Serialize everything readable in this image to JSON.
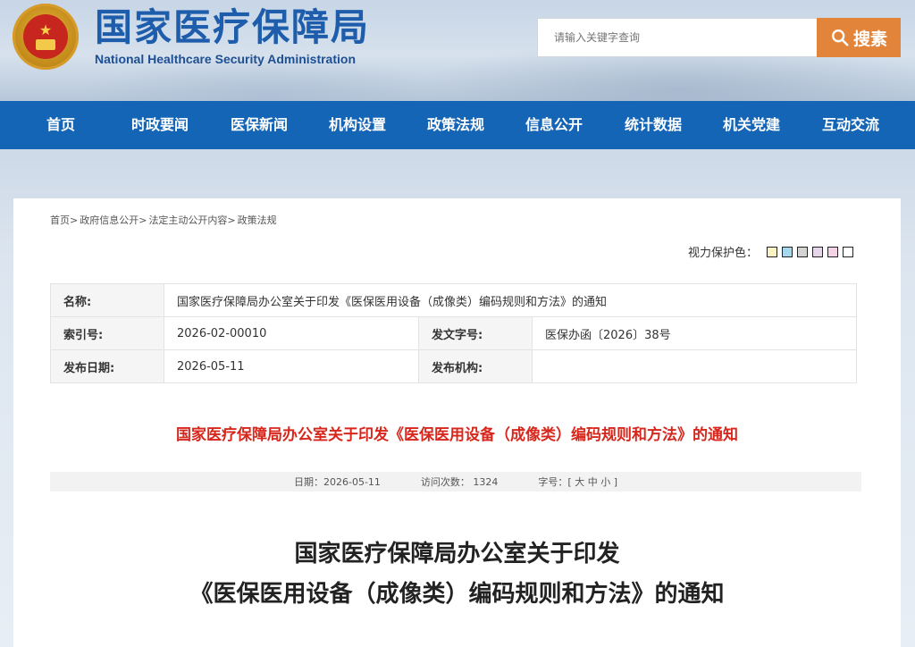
{
  "header": {
    "title_cn": "国家医疗保障局",
    "title_en": "National Healthcare Security Administration",
    "search_placeholder": "请输入关键字查询",
    "search_button": "搜素"
  },
  "nav": {
    "items": [
      "首页",
      "时政要闻",
      "医保新闻",
      "机构设置",
      "政策法规",
      "信息公开",
      "统计数据",
      "机关党建",
      "互动交流"
    ]
  },
  "breadcrumb": [
    "首页>",
    "政府信息公开>",
    "法定主动公开内容>",
    "政策法规"
  ],
  "vision": {
    "label": "视力保护色：",
    "colors": [
      "#fbf3c3",
      "#a5d8ef",
      "#d3d3d3",
      "#e5d4ea",
      "#f3d2e6",
      "#ffffff"
    ]
  },
  "meta": {
    "name_label": "名称:",
    "name_value": "国家医疗保障局办公室关于印发《医保医用设备（成像类）编码规则和方法》的通知",
    "index_label": "索引号:",
    "index_value": "2026-02-00010",
    "doc_no_label": "发文字号:",
    "doc_no_value": "医保办函〔2026〕38号",
    "date_label": "发布日期:",
    "date_value": "2026-05-11",
    "org_label": "发布机构:",
    "org_value": ""
  },
  "doc_title": "国家医疗保障局办公室关于印发《医保医用设备（成像类）编码规则和方法》的通知",
  "info_bar": {
    "date": "日期：2026-05-11",
    "visits": "访问次数：  1324",
    "font_label": "字号：[",
    "font_large": "大",
    "font_medium": "中",
    "font_small": "小",
    "font_close": "]"
  },
  "article": {
    "title_line1": "国家医疗保障局办公室关于印发",
    "title_line2": "《医保医用设备（成像类）编码规则和方法》的通知"
  }
}
